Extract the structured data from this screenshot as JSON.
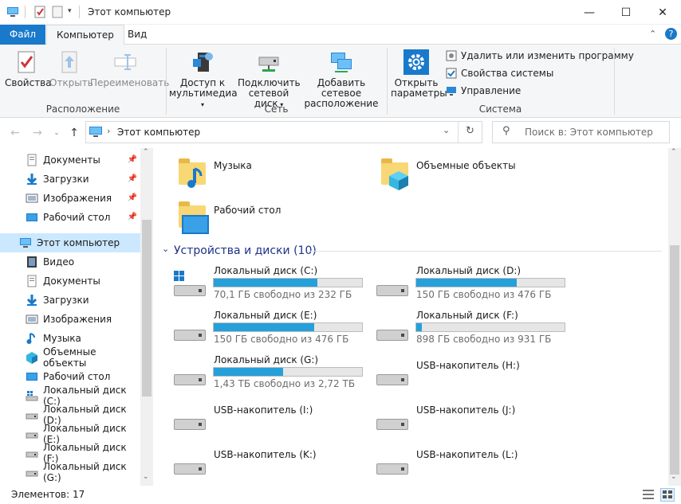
{
  "window": {
    "title": "Этот компьютер"
  },
  "tabs": {
    "file": "Файл",
    "computer": "Компьютер",
    "view": "Вид"
  },
  "ribbon": {
    "properties": "Свойства",
    "open": "Открыть",
    "rename": "Переименовать",
    "group_location": "Расположение",
    "media_access_l1": "Доступ к",
    "media_access_l2": "мультимедиа",
    "map_drive_l1": "Подключить",
    "map_drive_l2": "сетевой диск",
    "add_network_l1": "Добавить сетевое",
    "add_network_l2": "расположение",
    "group_network": "Сеть",
    "open_settings_l1": "Открыть",
    "open_settings_l2": "параметры",
    "uninstall": "Удалить или изменить программу",
    "system_props": "Свойства системы",
    "manage": "Управление",
    "group_system": "Система"
  },
  "address": {
    "path": "Этот компьютер",
    "search_placeholder": "Поиск в: Этот компьютер"
  },
  "nav": {
    "quick": [
      {
        "label": "Документы"
      },
      {
        "label": "Загрузки"
      },
      {
        "label": "Изображения"
      },
      {
        "label": "Рабочий стол"
      }
    ],
    "this_pc": "Этот компьютер",
    "items": [
      {
        "label": "Видео"
      },
      {
        "label": "Документы"
      },
      {
        "label": "Загрузки"
      },
      {
        "label": "Изображения"
      },
      {
        "label": "Музыка"
      },
      {
        "label": "Объемные объекты"
      },
      {
        "label": "Рабочий стол"
      },
      {
        "label": "Локальный диск (C:)"
      },
      {
        "label": "Локальный диск (D:)"
      },
      {
        "label": "Локальный диск (E:)"
      },
      {
        "label": "Локальный диск (F:)"
      },
      {
        "label": "Локальный диск (G:)"
      }
    ]
  },
  "folders": [
    {
      "name": "Музыка"
    },
    {
      "name": "Объемные объекты"
    },
    {
      "name": "Рабочий стол"
    }
  ],
  "devices_header": "Устройства и диски (10)",
  "drives": [
    {
      "name": "Локальный диск (C:)",
      "free": "70,1 ГБ свободно из 232 ГБ",
      "used_fraction": 0.7
    },
    {
      "name": "Локальный диск (D:)",
      "free": "150 ГБ свободно из 476 ГБ",
      "used_fraction": 0.68
    },
    {
      "name": "Локальный диск (E:)",
      "free": "150 ГБ свободно из 476 ГБ",
      "used_fraction": 0.68
    },
    {
      "name": "Локальный диск (F:)",
      "free": "898 ГБ свободно из 931 ГБ",
      "used_fraction": 0.04
    },
    {
      "name": "Локальный диск (G:)",
      "free": "1,43 ТБ свободно из 2,72 ТБ",
      "used_fraction": 0.47
    },
    {
      "name": "USB-накопитель (H:)"
    },
    {
      "name": "USB-накопитель (I:)"
    },
    {
      "name": "USB-накопитель (J:)"
    },
    {
      "name": "USB-накопитель (K:)"
    },
    {
      "name": "USB-накопитель (L:)"
    }
  ],
  "status": {
    "count": "Элементов: 17"
  },
  "colors": {
    "accent": "#1979ca",
    "bar_fill": "#26a0da",
    "selection": "#cce8ff"
  }
}
